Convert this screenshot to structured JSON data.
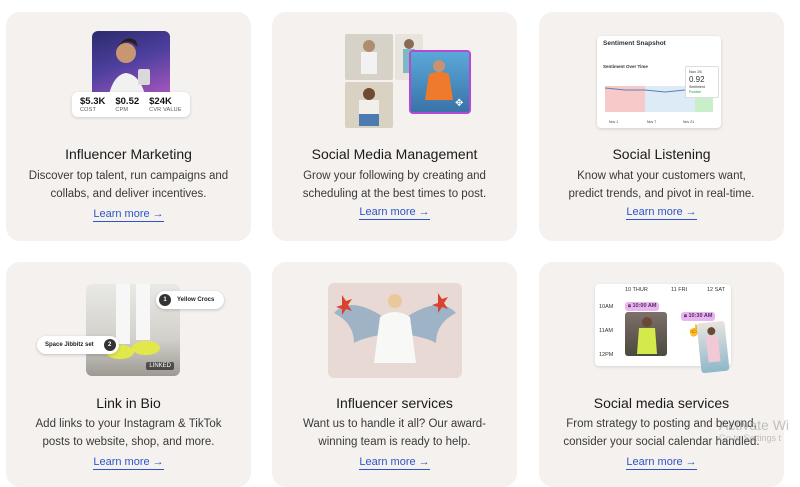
{
  "cards": [
    {
      "title": "Influencer Marketing",
      "desc_lines": [
        "Discover top talent, run campaigns and",
        "collabs, and deliver incentives."
      ],
      "link": "Learn more"
    },
    {
      "title": "Social Media Management",
      "desc_lines": [
        "Grow your following by creating and",
        "scheduling at the best times to post."
      ],
      "link": "Learn more"
    },
    {
      "title": "Social Listening",
      "desc_lines": [
        "Know what your customers want,",
        "predict trends, and pivot in real-time."
      ],
      "link": "Learn more"
    },
    {
      "title": "Link in Bio",
      "desc_lines": [
        "Add links to your Instagram & TikTok",
        "posts to website, shop, and more."
      ],
      "link": "Learn more"
    },
    {
      "title": "Influencer services",
      "desc_lines": [
        "Want us to handle it all? Our award-",
        "winning team is ready to help."
      ],
      "link": "Learn more"
    },
    {
      "title": "Social media services",
      "desc_lines": [
        "From strategy to posting and beyond,",
        "consider your social calendar handled."
      ],
      "link": "Learn more"
    }
  ],
  "influencer_stats": [
    {
      "value": "$5.3K",
      "label": "COST"
    },
    {
      "value": "$0.52",
      "label": "CPM"
    },
    {
      "value": "$24K",
      "label": "CVR VALUE"
    }
  ],
  "sentiment": {
    "title": "Sentiment Snapshot",
    "subtitle": "Sentiment Over Time",
    "tooltip_date": "Nov 26",
    "tooltip_value": "0.92",
    "tooltip_label": "Sentiment",
    "tooltip_status": "Positive",
    "x_ticks": [
      "Nov 1",
      "Nov 7",
      "Nov 21"
    ]
  },
  "linkbio": {
    "item1": "Yellow Crocs",
    "item1_num": "1",
    "item2": "Space Jibbitz set",
    "item2_num": "2",
    "badge": "LINKED"
  },
  "calendar": {
    "days": [
      "10 THUR",
      "11 FRI",
      "12 SAT"
    ],
    "times": [
      "10AM",
      "11AM",
      "12PM"
    ],
    "chip1": "10:00 AM",
    "chip2": "10:30 AM"
  },
  "watermark": {
    "line1": "Activate Wi",
    "line2": "Go to Settings t"
  },
  "arrow": "→",
  "colors": {
    "link": "#2d55c8",
    "card_bg": "#f4f1ee",
    "accent_purple": "#8a39d8"
  }
}
